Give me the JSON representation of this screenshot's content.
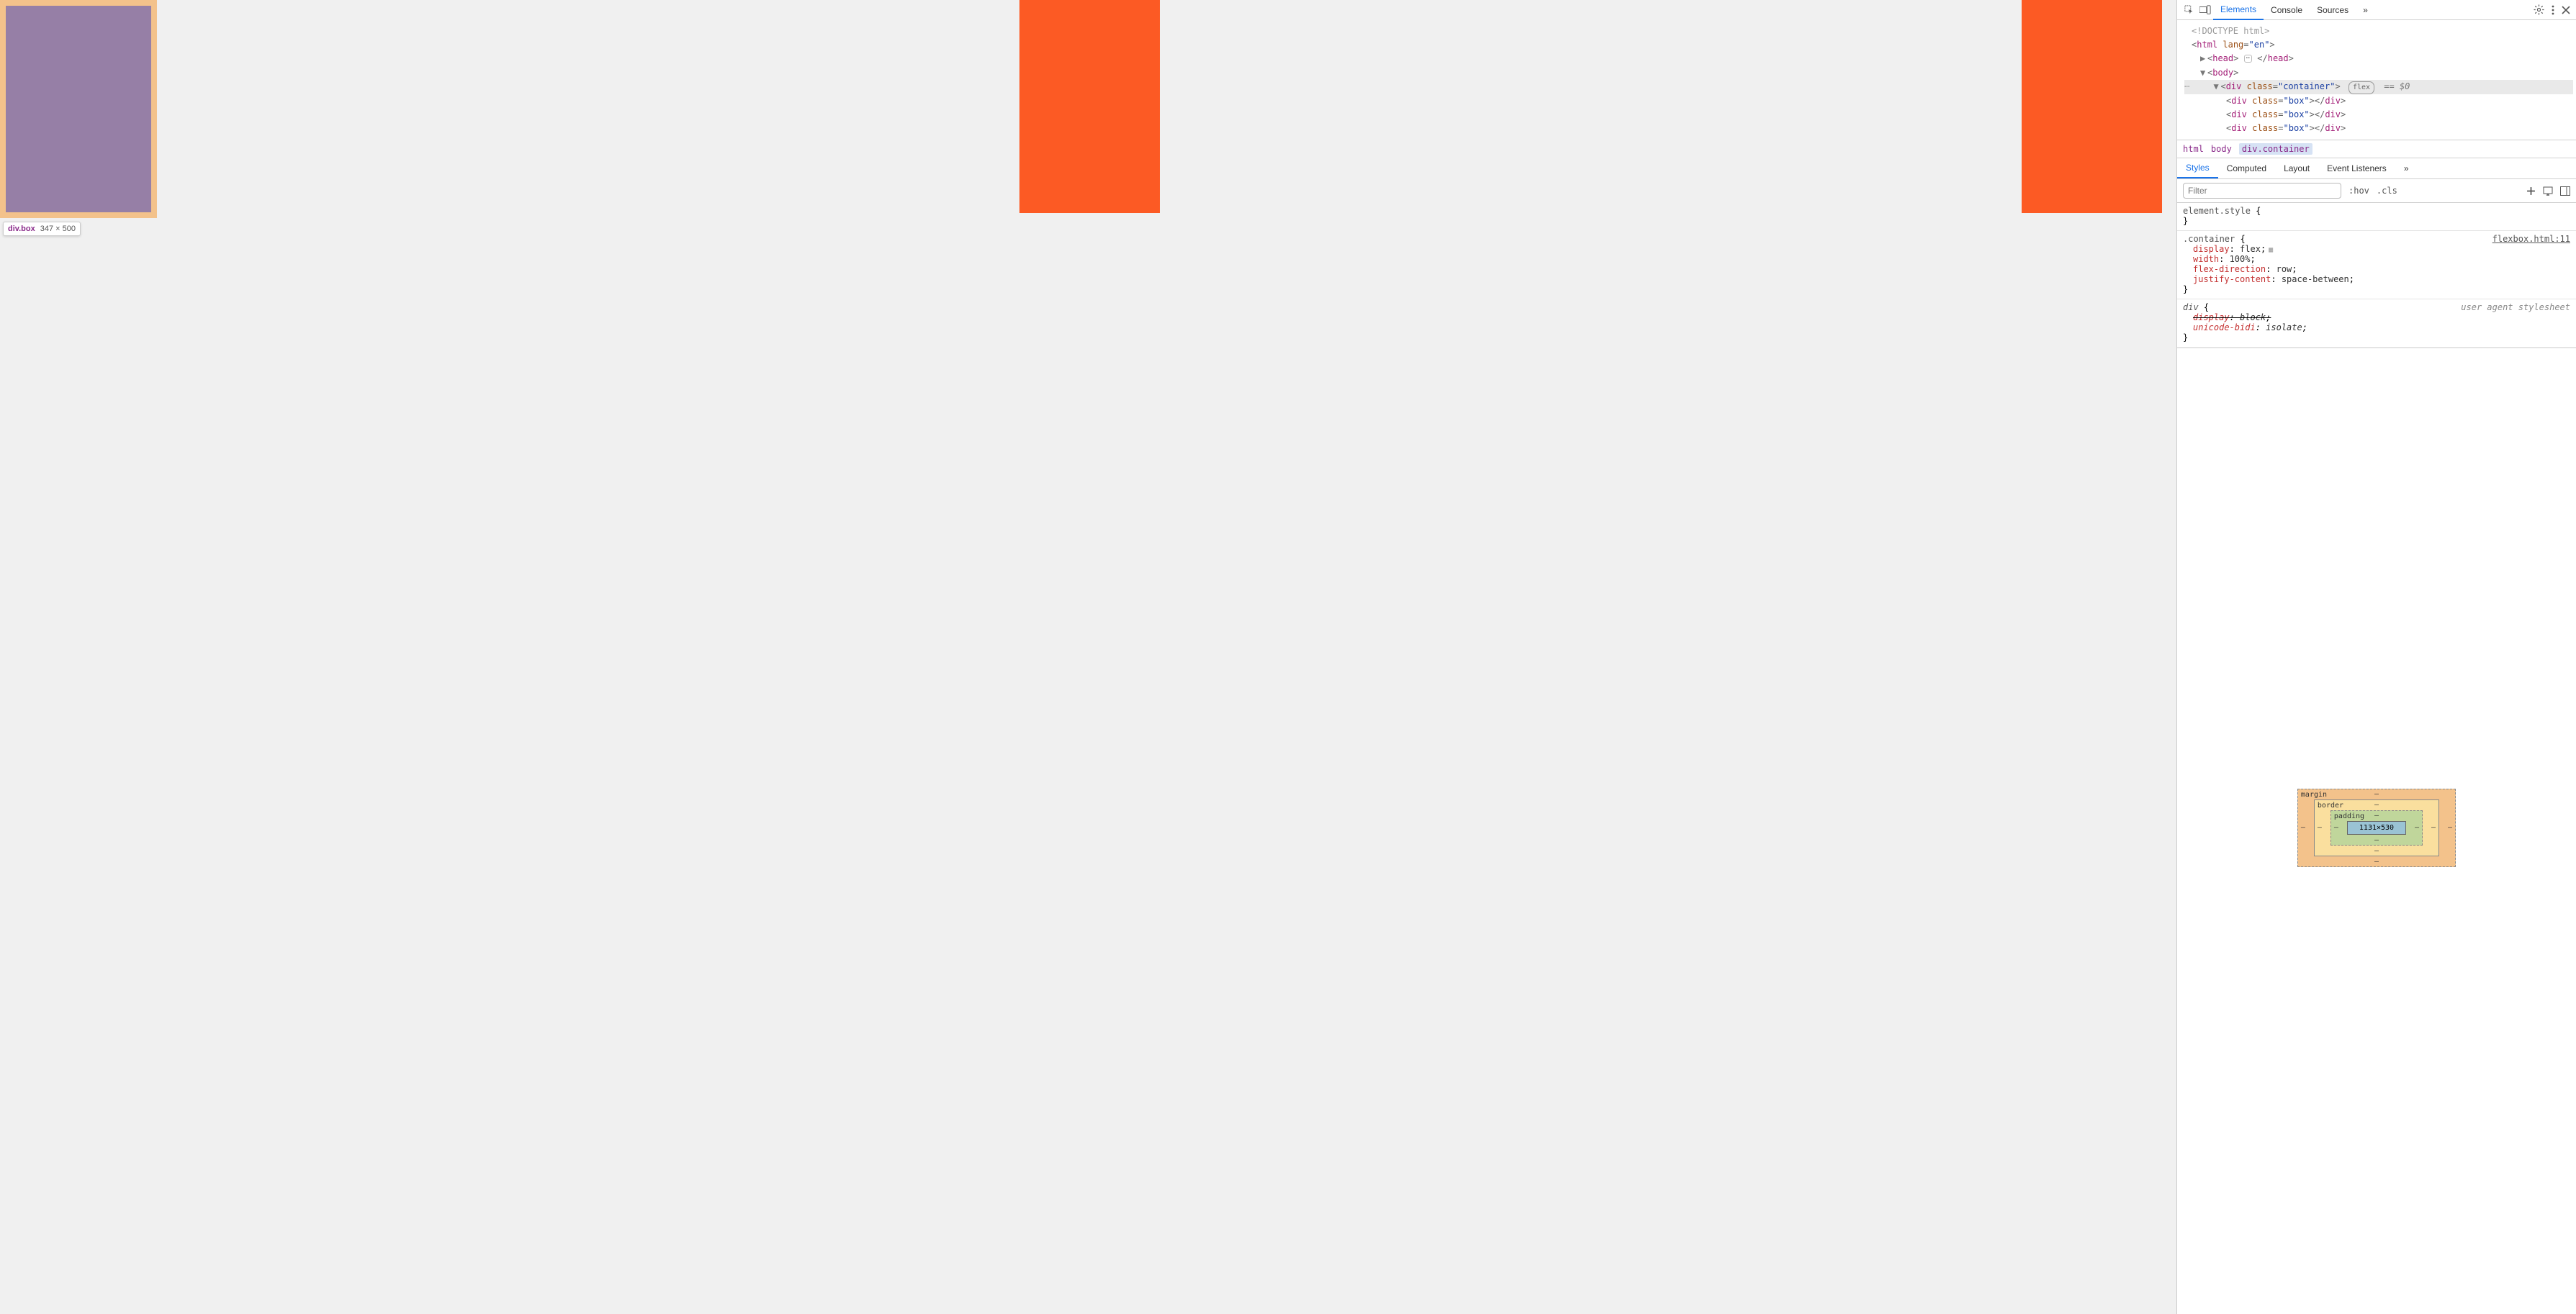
{
  "viewport": {
    "tooltip_selector": "div.box",
    "tooltip_dimensions": "347 × 500"
  },
  "topbar": {
    "tabs": [
      "Elements",
      "Console",
      "Sources"
    ],
    "more_glyph": "»",
    "active_index": 0
  },
  "dom": {
    "doctype": "<!DOCTYPE html>",
    "html_open_tag": "html",
    "html_lang_attr": "lang",
    "html_lang_val": "\"en\"",
    "head_tag": "head",
    "body_tag": "body",
    "container_tag": "div",
    "class_attr": "class",
    "container_class_val": "\"container\"",
    "flex_badge": "flex",
    "dollar0": "== $0",
    "box_tag": "div",
    "box_class_val": "\"box\""
  },
  "breadcrumb": {
    "items": [
      "html",
      "body",
      "div.container"
    ]
  },
  "styles_tabs": {
    "tabs": [
      "Styles",
      "Computed",
      "Layout",
      "Event Listeners"
    ],
    "more_glyph": "»",
    "active_index": 0
  },
  "filter": {
    "placeholder": "Filter",
    "hov": ":hov",
    "cls": ".cls"
  },
  "rules": {
    "element_style_selector": "element.style",
    "container_selector": ".container",
    "container_source": "flexbox.html:11",
    "container_props": {
      "display": "flex",
      "width": "100%",
      "flex_direction": "row",
      "justify_content": "space-between"
    },
    "div_selector": "div",
    "ua_label": "user agent stylesheet",
    "div_props": {
      "display": "block",
      "unicode_bidi": "isolate"
    }
  },
  "boxmodel": {
    "margin_label": "margin",
    "border_label": "border",
    "padding_label": "padding",
    "content": "1131×530",
    "dash": "–"
  }
}
